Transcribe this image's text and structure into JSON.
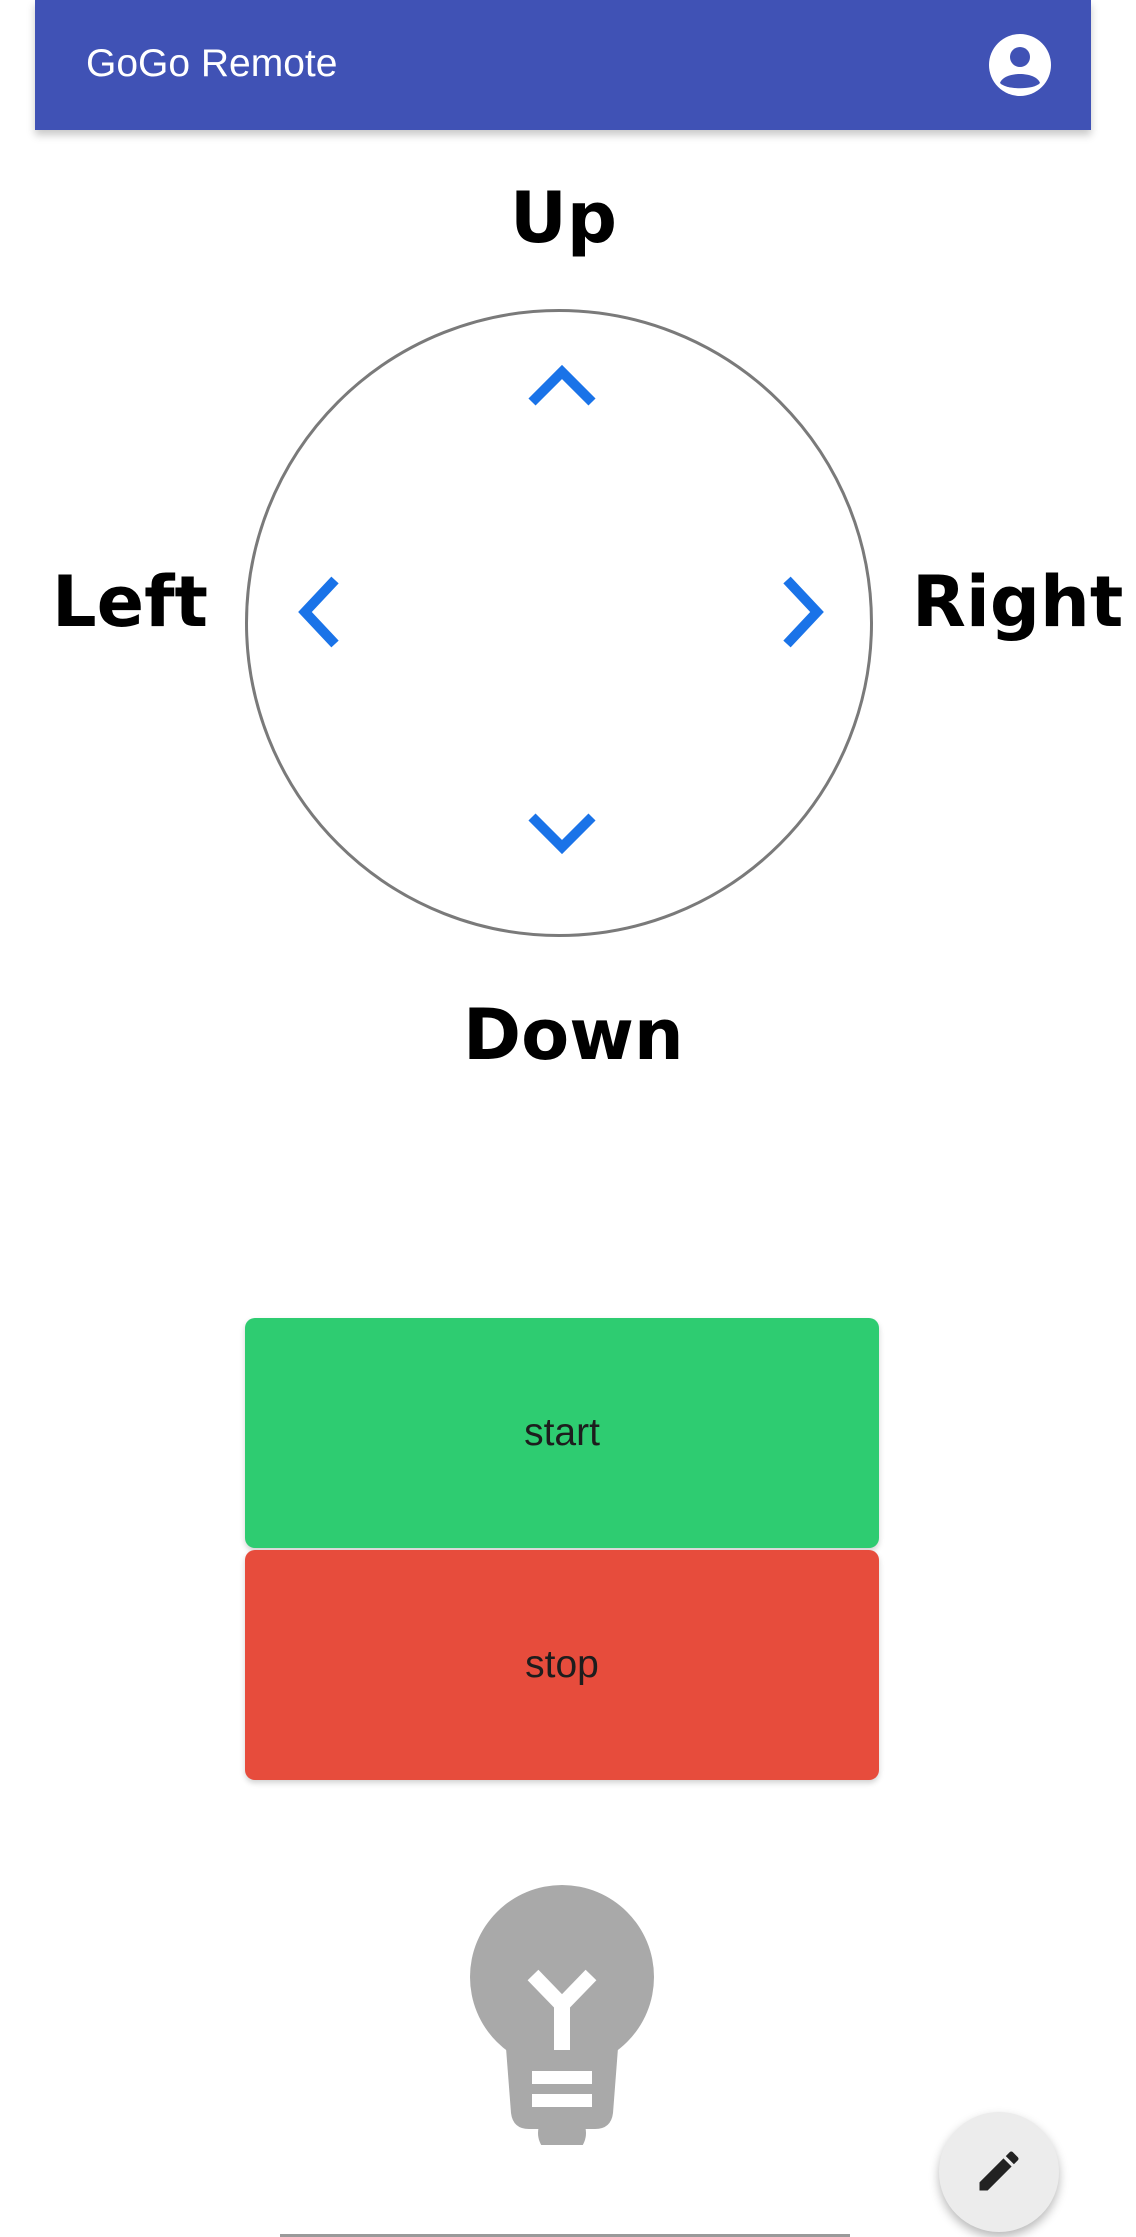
{
  "app": {
    "title": "GoGo Remote",
    "account_icon": "account-circle-icon",
    "accent_color": "#4052b5"
  },
  "joystick": {
    "labels": {
      "up": "Up",
      "left": "Left",
      "right": "Right",
      "down": "Down"
    },
    "arrow_icons": {
      "up": "chevron-up-icon",
      "down": "chevron-down-icon",
      "left": "chevron-left-icon",
      "right": "chevron-right-icon"
    },
    "arrow_color": "#1a73e8"
  },
  "controls": {
    "start_label": "start",
    "start_color": "#2ecc71",
    "stop_label": "stop",
    "stop_color": "#e74c3c"
  },
  "indicator": {
    "icon": "lightbulb-icon",
    "state": "off",
    "color": "#a9a9a9"
  },
  "fab": {
    "icon": "pencil-icon"
  }
}
